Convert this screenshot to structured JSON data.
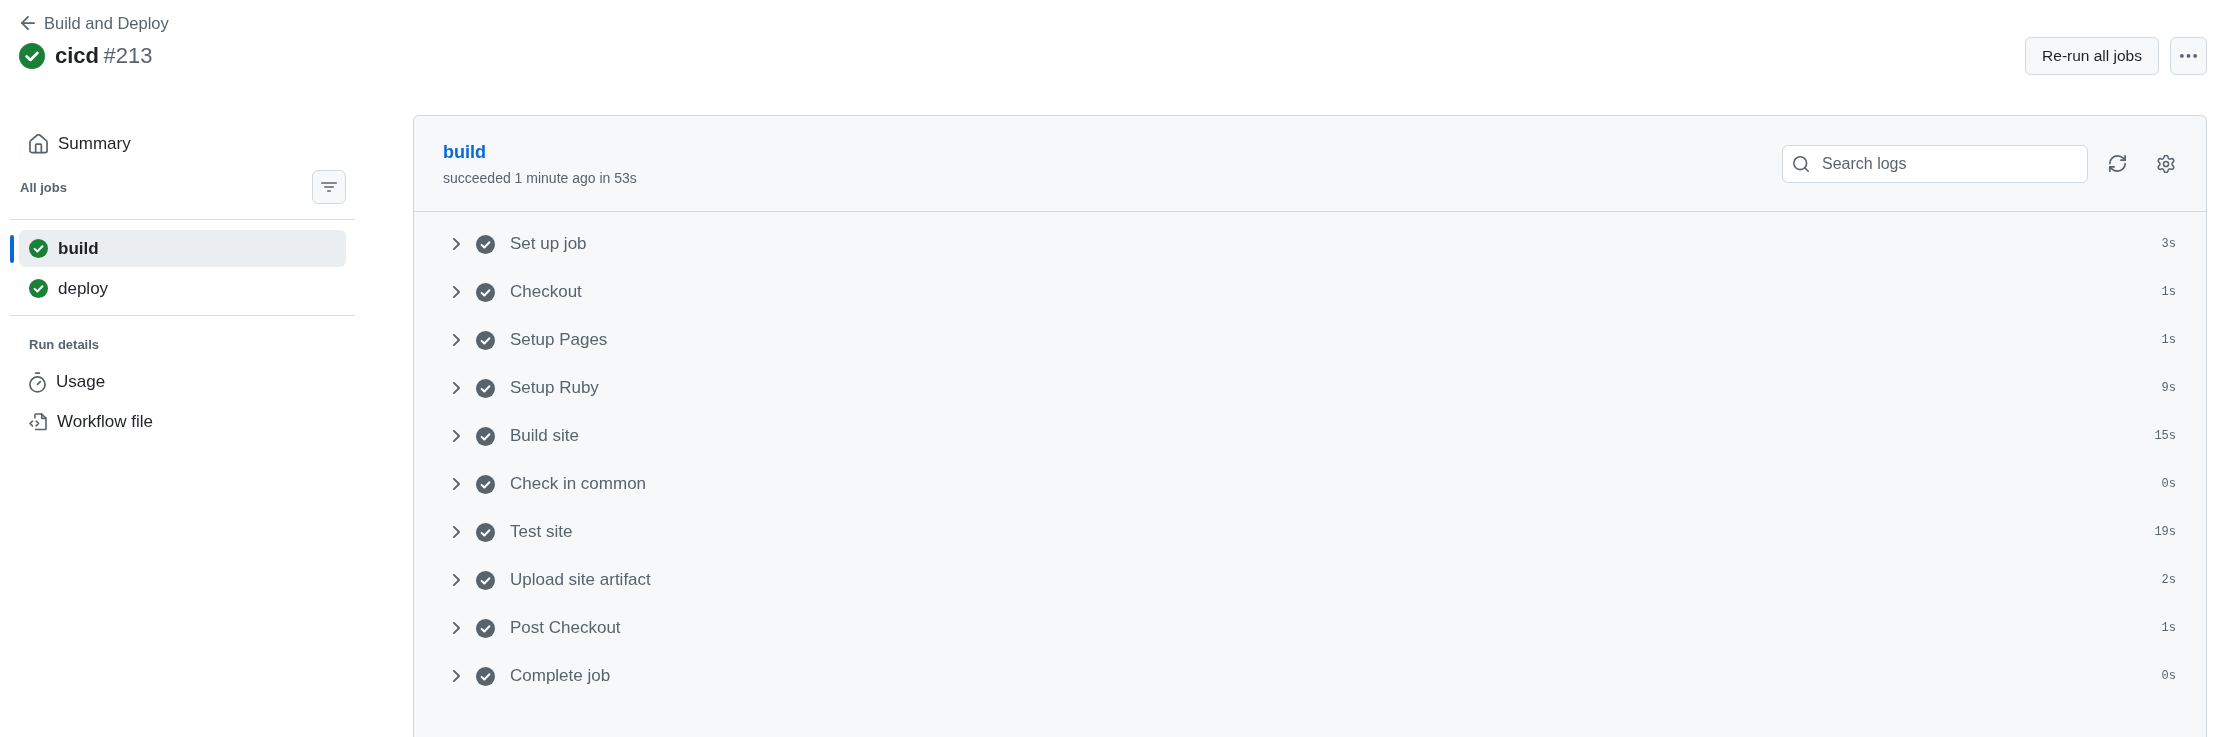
{
  "header": {
    "back_link": "Build and Deploy",
    "succeeded": true,
    "workflow": "cicd",
    "run_number": "#213",
    "rerun_button": "Re-run all jobs"
  },
  "sidebar": {
    "summary": "Summary",
    "jobs_heading": "All jobs",
    "jobs": [
      {
        "name": "build",
        "succeeded": true,
        "selected": true
      },
      {
        "name": "deploy",
        "succeeded": true,
        "selected": false
      }
    ],
    "run_details_heading": "Run details",
    "run_details": [
      {
        "kind": "usage",
        "label": "Usage"
      },
      {
        "kind": "workflow_file",
        "label": "Workflow file"
      }
    ]
  },
  "job": {
    "name": "build",
    "summary": "succeeded 1 minute ago in 53s",
    "search": {
      "placeholder": "Search logs"
    },
    "steps": [
      {
        "name": "Set up job",
        "duration": "3s",
        "succeeded": true,
        "expanded": false
      },
      {
        "name": "Checkout",
        "duration": "1s",
        "succeeded": true,
        "expanded": false
      },
      {
        "name": "Setup Pages",
        "duration": "1s",
        "succeeded": true,
        "expanded": false
      },
      {
        "name": "Setup Ruby",
        "duration": "9s",
        "succeeded": true,
        "expanded": false
      },
      {
        "name": "Build site",
        "duration": "15s",
        "succeeded": true,
        "expanded": false
      },
      {
        "name": "Check in common",
        "duration": "0s",
        "succeeded": true,
        "expanded": false
      },
      {
        "name": "Test site",
        "duration": "19s",
        "succeeded": true,
        "expanded": false
      },
      {
        "name": "Upload site artifact",
        "duration": "2s",
        "succeeded": true,
        "expanded": false
      },
      {
        "name": "Post Checkout",
        "duration": "1s",
        "succeeded": true,
        "expanded": false
      },
      {
        "name": "Complete job",
        "duration": "0s",
        "succeeded": true,
        "expanded": false
      }
    ]
  }
}
